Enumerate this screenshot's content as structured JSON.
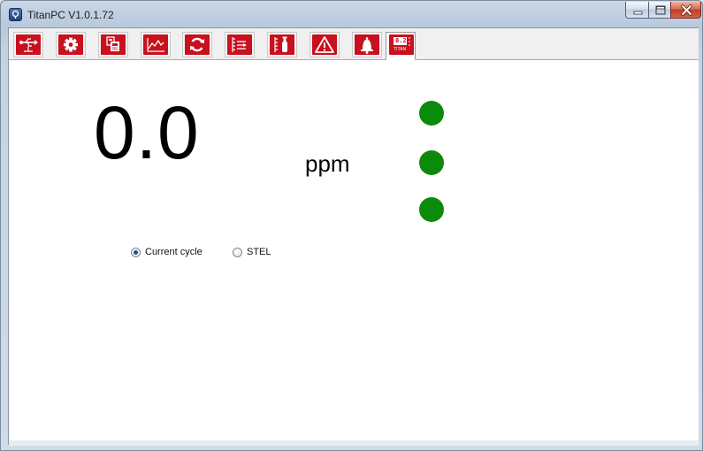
{
  "window": {
    "title": "TitanPC V1.0.1.72",
    "controls": [
      "minimize-icon",
      "maximize-icon",
      "close-icon"
    ]
  },
  "toolbar": {
    "buttons": [
      {
        "icon": "usb-connect-icon"
      },
      {
        "icon": "gear-icon"
      },
      {
        "icon": "device-settings-icon"
      },
      {
        "icon": "line-graph-icon"
      },
      {
        "icon": "refresh-icon"
      },
      {
        "icon": "data-log-icon"
      },
      {
        "icon": "calibration-icon"
      },
      {
        "icon": "warning-icon"
      },
      {
        "icon": "alarm-bell-icon"
      },
      {
        "icon": "titan-display-icon",
        "active": true,
        "display_text": "0.2",
        "brand_text": "TITAN"
      }
    ]
  },
  "reading": {
    "value": "0.0",
    "unit": "ppm"
  },
  "indicators": {
    "color": "#0b8a0b",
    "count": 3
  },
  "mode": {
    "options": [
      "Current cycle",
      "STEL"
    ],
    "selected": "Current cycle"
  },
  "colors": {
    "accent": "#c8101e",
    "led_on": "#0b8a0b"
  }
}
